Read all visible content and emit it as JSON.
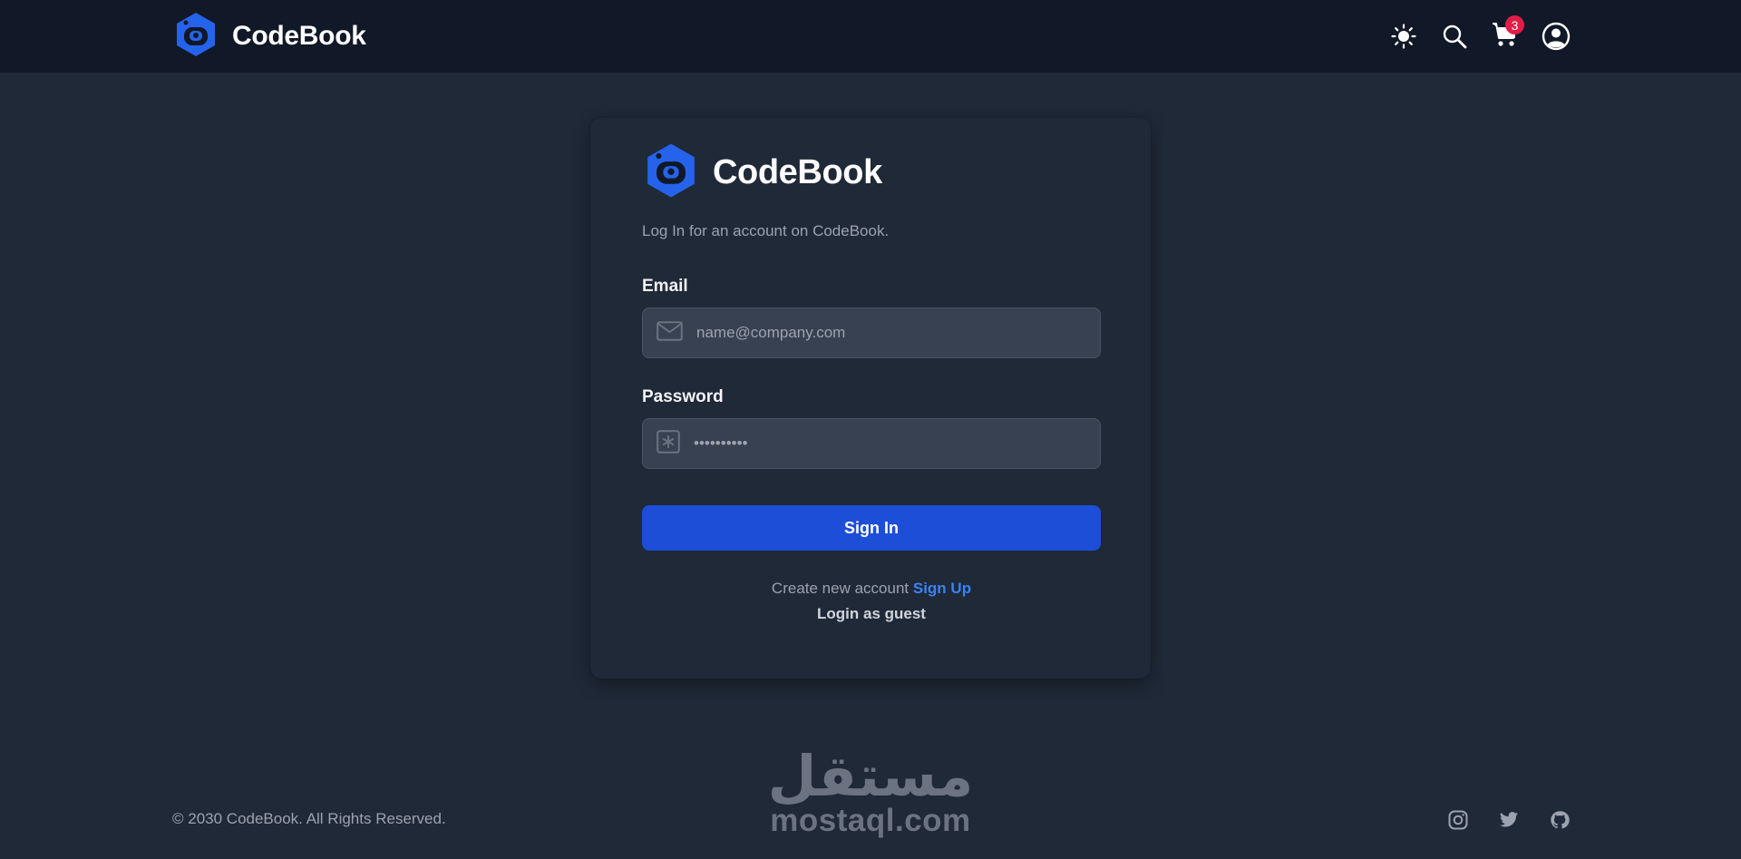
{
  "header": {
    "brand_name": "CodeBook",
    "cart_count": "3",
    "icons": [
      "theme-toggle-icon",
      "search-icon",
      "cart-icon",
      "user-icon"
    ]
  },
  "login": {
    "brand_name": "CodeBook",
    "subtitle": "Log In for an account on CodeBook.",
    "email_label": "Email",
    "email_placeholder": "name@company.com",
    "password_label": "Password",
    "password_value": "••••••••••",
    "signin_label": "Sign In",
    "create_text": "Create new account",
    "signup_label": "Sign Up",
    "guest_label": "Login as guest"
  },
  "footer": {
    "copyright": "© 2030 CodeBook. All Rights Reserved.",
    "social": [
      "instagram-icon",
      "twitter-icon",
      "github-icon"
    ]
  },
  "watermark": {
    "arabic": "مستقل",
    "latin": "mostaql.com"
  },
  "colors": {
    "background": "#1f2937",
    "header_bg": "#111827",
    "accent": "#1d4ed8",
    "link": "#3b82f6",
    "badge": "#e11d48",
    "logo": "#2563eb"
  }
}
